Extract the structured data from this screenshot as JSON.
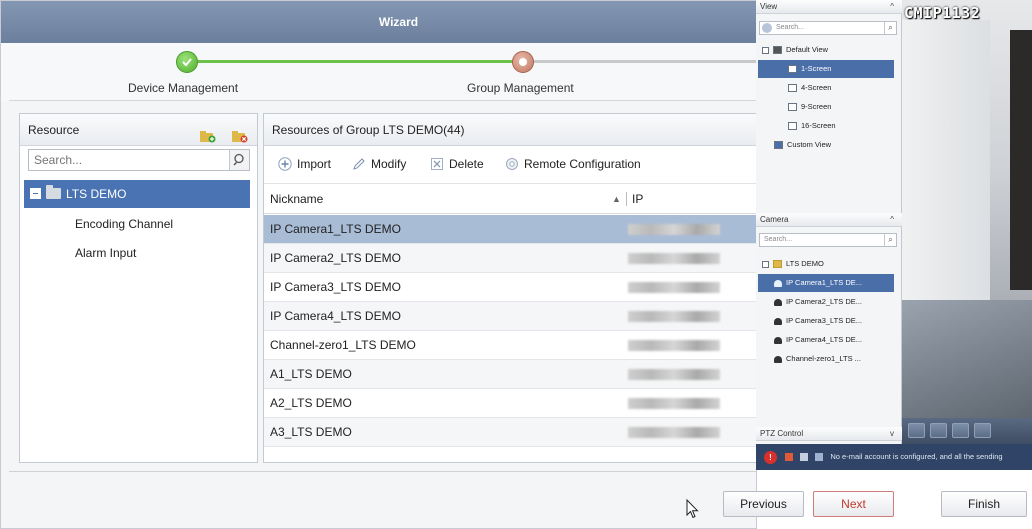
{
  "wizard": {
    "title": "Wizard",
    "steps": [
      {
        "label": "Device Management",
        "state": "done"
      },
      {
        "label": "Group Management",
        "state": "current"
      }
    ]
  },
  "resource_panel": {
    "title": "Resource",
    "search_placeholder": "Search...",
    "tree": {
      "root": "LTS DEMO",
      "children": [
        "Encoding Channel",
        "Alarm Input"
      ]
    }
  },
  "group_panel": {
    "title": "Resources of Group LTS DEMO(44)",
    "toolbar": {
      "import": "Import",
      "modify": "Modify",
      "delete": "Delete",
      "remote": "Remote Configuration"
    },
    "columns": {
      "nickname": "Nickname",
      "ip": "IP"
    },
    "rows": [
      {
        "nickname": "IP Camera1_LTS DEMO",
        "selected": true
      },
      {
        "nickname": "IP Camera2_LTS DEMO",
        "selected": false
      },
      {
        "nickname": "IP Camera3_LTS DEMO",
        "selected": false
      },
      {
        "nickname": "IP Camera4_LTS DEMO",
        "selected": false
      },
      {
        "nickname": "Channel-zero1_LTS DEMO",
        "selected": false
      },
      {
        "nickname": "A1_LTS DEMO",
        "selected": false
      },
      {
        "nickname": "A2_LTS DEMO",
        "selected": false
      },
      {
        "nickname": "A3_LTS DEMO",
        "selected": false
      }
    ]
  },
  "buttons": {
    "previous": "Previous",
    "next": "Next",
    "finish": "Finish"
  },
  "liveview": {
    "view_title": "View",
    "search_placeholder": "Search...",
    "default_view": "Default View",
    "screens": [
      "1-Screen",
      "4-Screen",
      "9-Screen",
      "16-Screen"
    ],
    "custom_view": "Custom View",
    "camera_title": "Camera",
    "camera_search": "Search...",
    "camera_group": "LTS DEMO",
    "cameras": [
      "IP Camera1_LTS DE...",
      "IP Camera2_LTS DE...",
      "IP Camera3_LTS DE...",
      "IP Camera4_LTS DE...",
      "Channel-zero1_LTS ..."
    ],
    "ptz_title": "PTZ Control",
    "osd_text": "CMIP1132",
    "status_text": "No e-mail account is configured, and all the sending"
  },
  "colors": {
    "titlebar": "#7a8daa",
    "selected_tree": "#4a73b3",
    "selected_row": "#a9bcd6",
    "step_done": "#6cc24a",
    "step_current": "#c07864",
    "next_button_text": "#c0392b"
  }
}
